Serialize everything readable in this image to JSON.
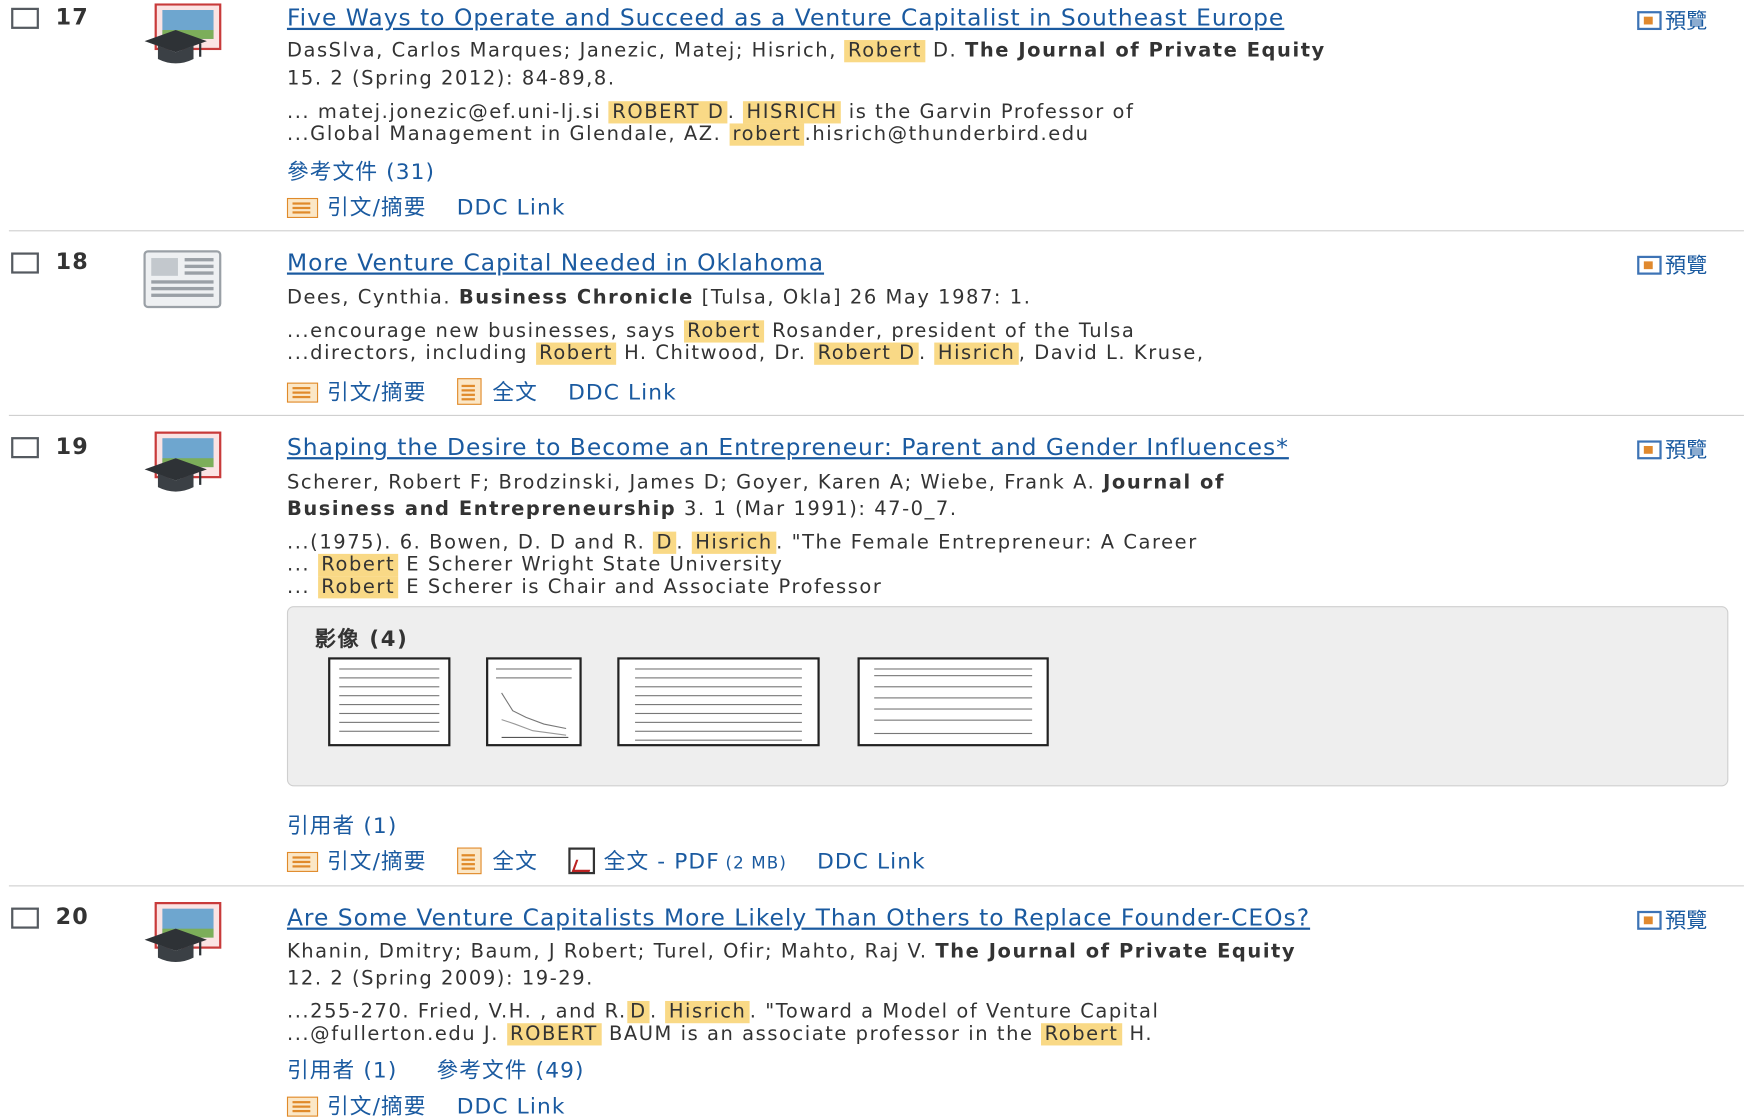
{
  "preview_label": "預覽",
  "records": [
    {
      "number": "17",
      "title": "Five Ways to Operate and Succeed as a Venture Capitalist in Southeast Europe",
      "authors": "DasSlva, Carlos Marques; Janezic, Matej; Hisrich, ",
      "auth_hl": "Robert",
      "auth_rest": " D. ",
      "journal": "The Journal of Private Equity",
      "citation_line2": "15. 2 (Spring 2012): 84-89,8.",
      "snip1_pre": "... matej.jonezic@ef.uni-lj.si ",
      "snip1_hl1": "ROBERT D",
      "snip1_mid": ". ",
      "snip1_hl2": "HISRICH",
      "snip1_post": " is the Garvin Professor of",
      "snip2_pre": "...Global Management in Glendale, AZ. ",
      "snip2_hl": "robert",
      "snip2_post": ".hisrich@thunderbird.edu",
      "refs": "參考文件 (31)",
      "link_cite": "引文/摘要",
      "link_ddc": "DDC Link"
    },
    {
      "number": "18",
      "title": "More Venture Capital Needed in Oklahoma",
      "authors": "Dees, Cynthia. ",
      "journal": "Business Chronicle",
      "citation_tail": " [Tulsa, Okla] 26 May 1987: 1.",
      "snip1_pre": "...encourage new businesses, says ",
      "snip1_hl": "Robert",
      "snip1_post": " Rosander, president of the Tulsa",
      "snip2_pre": "...directors, including ",
      "snip2_hl1": "Robert",
      "snip2_mid1": " H. Chitwood, Dr. ",
      "snip2_hl2": "Robert D",
      "snip2_mid2": ". ",
      "snip2_hl3": "Hisrich",
      "snip2_post": ", David L. Kruse,",
      "link_cite": "引文/摘要",
      "link_full": "全文",
      "link_ddc": "DDC Link"
    },
    {
      "number": "19",
      "title": "Shaping the Desire to Become an Entrepreneur: Parent and Gender Influences*",
      "authors": "Scherer, Robert F; Brodzinski, James D; Goyer, Karen A; Wiebe, Frank A. ",
      "journal_a": "Journal of",
      "journal_b": "Business and Entrepreneurship",
      "citation_tail": " 3. 1 (Mar 1991): 47-0_7.",
      "snip1_pre": "...(1975). 6. Bowen, D. D and R. ",
      "snip1_hl1": "D",
      "snip1_mid": ". ",
      "snip1_hl2": "Hisrich",
      "snip1_post": ". \"The Female Entrepreneur: A Career",
      "snip2_pre": "... ",
      "snip2_hl": "Robert",
      "snip2_post": " E Scherer Wright State University",
      "snip3_pre": "... ",
      "snip3_hl": "Robert",
      "snip3_post": " E Scherer is Chair and Associate Professor",
      "images_label": "影像 (4)",
      "cited_by": "引用者 (1)",
      "link_cite": "引文/摘要",
      "link_full": "全文",
      "link_pdf": "全文 - PDF",
      "pdf_size": "(2 MB)",
      "link_ddc": "DDC Link"
    },
    {
      "number": "20",
      "title": "Are Some Venture Capitalists More Likely Than Others to Replace Founder-CEOs?",
      "authors": "Khanin, Dmitry; Baum, J Robert; Turel, Ofir; Mahto, Raj V. ",
      "journal": "The Journal of Private Equity",
      "citation_line2": "12. 2 (Spring 2009): 19-29.",
      "snip1_pre": "...255-270. Fried, V.H. , and R.",
      "snip1_hl1": "D",
      "snip1_mid": ". ",
      "snip1_hl2": "Hisrich",
      "snip1_post": ". \"Toward a Model of Venture Capital",
      "snip2_pre": "...@fullerton.edu J. ",
      "snip2_hl1": "ROBERT",
      "snip2_mid": " BAUM is an associate professor in the ",
      "snip2_hl2": "Robert",
      "snip2_post": " H.",
      "cited_by": "引用者 (1)",
      "refs": "參考文件 (49)",
      "link_cite": "引文/摘要",
      "link_ddc": "DDC Link"
    }
  ]
}
